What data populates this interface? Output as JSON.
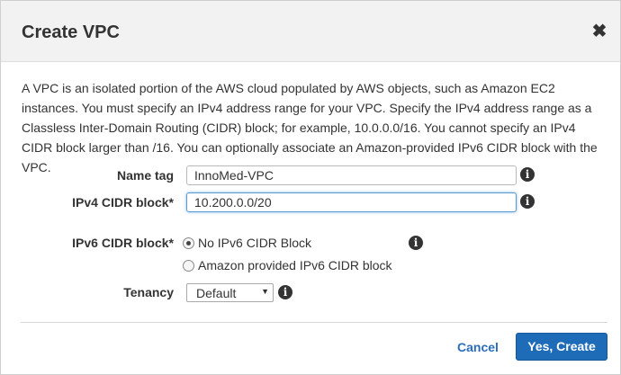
{
  "dialog": {
    "title": "Create VPC",
    "close_symbol": "✖",
    "description": "A VPC is an isolated portion of the AWS cloud populated by AWS objects, such as Amazon EC2 instances. You must specify an IPv4 address range for your VPC. Specify the IPv4 address range as a Classless Inter-Domain Routing (CIDR) block; for example, 10.0.0.0/16. You cannot specify an IPv4 CIDR block larger than /16. You can optionally associate an Amazon-provided IPv6 CIDR block with the VPC."
  },
  "form": {
    "name_tag": {
      "label": "Name tag",
      "value": "InnoMed-VPC",
      "info_icon": "info-icon"
    },
    "ipv4_cidr": {
      "label": "IPv4 CIDR block*",
      "value": "10.200.0.0/20",
      "info_icon": "info-icon"
    },
    "ipv6_cidr": {
      "label": "IPv6 CIDR block*",
      "options": [
        {
          "label": "No IPv6 CIDR Block",
          "selected": true
        },
        {
          "label": "Amazon provided IPv6 CIDR block",
          "selected": false
        }
      ],
      "info_icon": "info-icon"
    },
    "tenancy": {
      "label": "Tenancy",
      "value": "Default",
      "info_icon": "info-icon"
    }
  },
  "footer": {
    "cancel_label": "Cancel",
    "confirm_label": "Yes, Create",
    "primary_color": "#1e6bb8",
    "link_color": "#2a6dbf"
  }
}
